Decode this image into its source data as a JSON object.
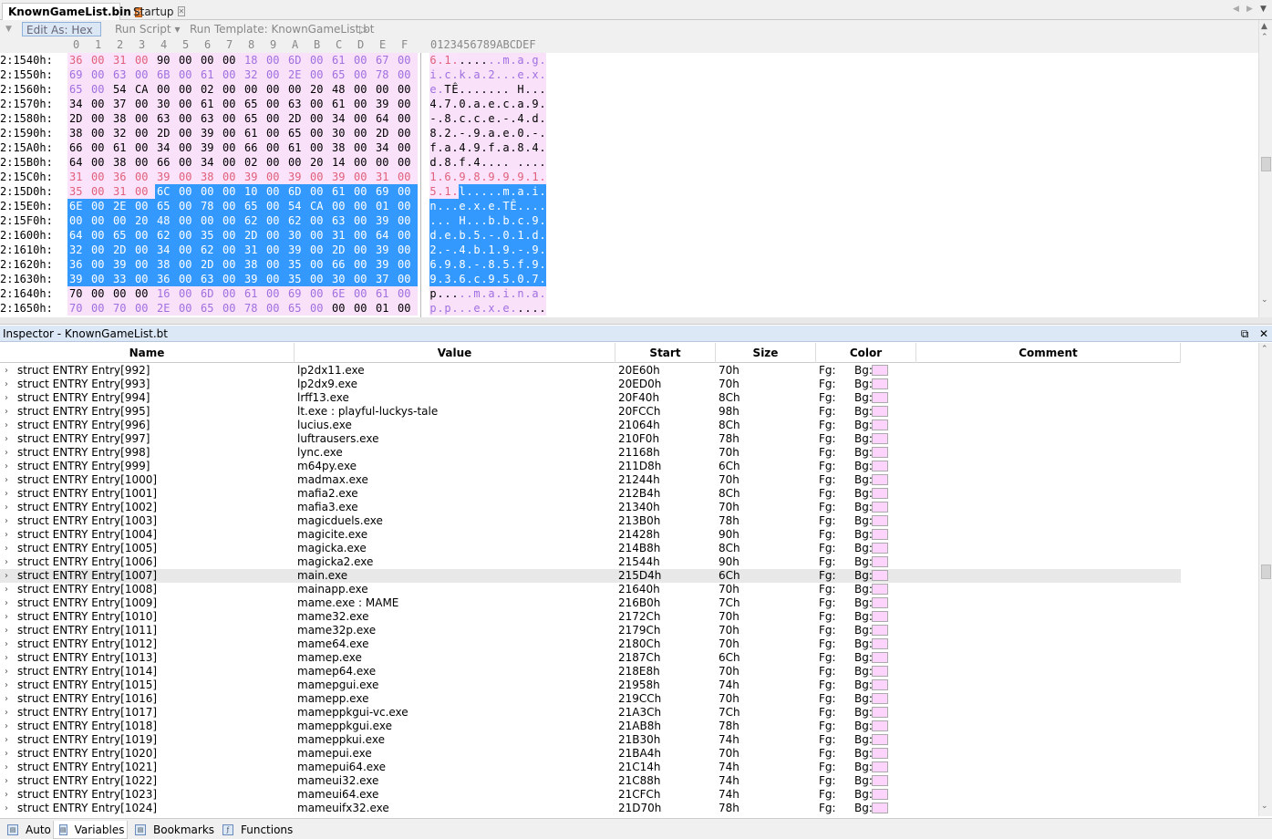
{
  "tabs": [
    {
      "label": "KnownGameList.bin",
      "active": true
    },
    {
      "label": "Startup",
      "active": false
    }
  ],
  "toolbar": {
    "edit_as": "Edit As: Hex",
    "run_script": "Run Script",
    "run_template": "Run Template: KnownGameList.bt"
  },
  "hex_columns": [
    "0",
    "1",
    "2",
    "3",
    "4",
    "5",
    "6",
    "7",
    "8",
    "9",
    "A",
    "B",
    "C",
    "D",
    "E",
    "F"
  ],
  "char_header": "0123456789ABCDEF",
  "colors": {
    "pink_bg": "#fbe3fb",
    "pink_text": "#e0607a",
    "lilac_text": "#a070e0",
    "selection": "#3399ff",
    "template_bg": "#f9e1f9"
  },
  "hex_rows": [
    {
      "addr": "2:1540h:",
      "bytes": [
        "36",
        "00",
        "31",
        "00",
        "90",
        "00",
        "00",
        "00",
        "18",
        "00",
        "6D",
        "00",
        "61",
        "00",
        "67",
        "00"
      ],
      "ascii": "6.1.......m.a.g.",
      "styles": "RRRRWWWWLLLLLLLL"
    },
    {
      "addr": "2:1550h:",
      "bytes": [
        "69",
        "00",
        "63",
        "00",
        "6B",
        "00",
        "61",
        "00",
        "32",
        "00",
        "2E",
        "00",
        "65",
        "00",
        "78",
        "00"
      ],
      "ascii": "i.c.k.a.2...e.x.",
      "styles": "LLLLLLLLLLLLLLLL"
    },
    {
      "addr": "2:1560h:",
      "bytes": [
        "65",
        "00",
        "54",
        "CA",
        "00",
        "00",
        "02",
        "00",
        "00",
        "00",
        "00",
        "20",
        "48",
        "00",
        "00",
        "00"
      ],
      "ascii": "e.TÊ....... H...",
      "styles": "LLWWWWWWWWWWWWWW"
    },
    {
      "addr": "2:1570h:",
      "bytes": [
        "34",
        "00",
        "37",
        "00",
        "30",
        "00",
        "61",
        "00",
        "65",
        "00",
        "63",
        "00",
        "61",
        "00",
        "39",
        "00"
      ],
      "ascii": "4.7.0.a.e.c.a.9.",
      "styles": "WWWWWWWWWWWWWWWW"
    },
    {
      "addr": "2:1580h:",
      "bytes": [
        "2D",
        "00",
        "38",
        "00",
        "63",
        "00",
        "63",
        "00",
        "65",
        "00",
        "2D",
        "00",
        "34",
        "00",
        "64",
        "00"
      ],
      "ascii": "-.8.c.c.e.-.4.d.",
      "styles": "WWWWWWWWWWWWWWWW"
    },
    {
      "addr": "2:1590h:",
      "bytes": [
        "38",
        "00",
        "32",
        "00",
        "2D",
        "00",
        "39",
        "00",
        "61",
        "00",
        "65",
        "00",
        "30",
        "00",
        "2D",
        "00"
      ],
      "ascii": "8.2.-.9.a.e.0.-.",
      "styles": "WWWWWWWWWWWWWWWW"
    },
    {
      "addr": "2:15A0h:",
      "bytes": [
        "66",
        "00",
        "61",
        "00",
        "34",
        "00",
        "39",
        "00",
        "66",
        "00",
        "61",
        "00",
        "38",
        "00",
        "34",
        "00"
      ],
      "ascii": "f.a.4.9.f.a.8.4.",
      "styles": "WWWWWWWWWWWWWWWW"
    },
    {
      "addr": "2:15B0h:",
      "bytes": [
        "64",
        "00",
        "38",
        "00",
        "66",
        "00",
        "34",
        "00",
        "02",
        "00",
        "00",
        "20",
        "14",
        "00",
        "00",
        "00"
      ],
      "ascii": "d.8.f.4.... ....",
      "styles": "WWWWWWWWWWWWWWWW"
    },
    {
      "addr": "2:15C0h:",
      "bytes": [
        "31",
        "00",
        "36",
        "00",
        "39",
        "00",
        "38",
        "00",
        "39",
        "00",
        "39",
        "00",
        "39",
        "00",
        "31",
        "00"
      ],
      "ascii": "1.6.9.8.9.9.9.1.",
      "styles": "RRRRRRRRRRRRRRRR"
    },
    {
      "addr": "2:15D0h:",
      "bytes": [
        "35",
        "00",
        "31",
        "00",
        "6C",
        "00",
        "00",
        "00",
        "10",
        "00",
        "6D",
        "00",
        "61",
        "00",
        "69",
        "00"
      ],
      "ascii": "5.1.l.....m.a.i.",
      "styles": "RRRRSSSSSSSSSSSS"
    },
    {
      "addr": "2:15E0h:",
      "bytes": [
        "6E",
        "00",
        "2E",
        "00",
        "65",
        "00",
        "78",
        "00",
        "65",
        "00",
        "54",
        "CA",
        "00",
        "00",
        "01",
        "00"
      ],
      "ascii": "n...e.x.e.TÊ....",
      "styles": "SSSSSSSSSSSSSSSS"
    },
    {
      "addr": "2:15F0h:",
      "bytes": [
        "00",
        "00",
        "00",
        "20",
        "48",
        "00",
        "00",
        "00",
        "62",
        "00",
        "62",
        "00",
        "63",
        "00",
        "39",
        "00"
      ],
      "ascii": "... H...b.b.c.9.",
      "styles": "SSSSSSSSSSSSSSSS"
    },
    {
      "addr": "2:1600h:",
      "bytes": [
        "64",
        "00",
        "65",
        "00",
        "62",
        "00",
        "35",
        "00",
        "2D",
        "00",
        "30",
        "00",
        "31",
        "00",
        "64",
        "00"
      ],
      "ascii": "d.e.b.5.-.0.1.d.",
      "styles": "SSSSSSSSSSSSSSSS"
    },
    {
      "addr": "2:1610h:",
      "bytes": [
        "32",
        "00",
        "2D",
        "00",
        "34",
        "00",
        "62",
        "00",
        "31",
        "00",
        "39",
        "00",
        "2D",
        "00",
        "39",
        "00"
      ],
      "ascii": "2.-.4.b.1.9.-.9.",
      "styles": "SSSSSSSSSSSSSSSS"
    },
    {
      "addr": "2:1620h:",
      "bytes": [
        "36",
        "00",
        "39",
        "00",
        "38",
        "00",
        "2D",
        "00",
        "38",
        "00",
        "35",
        "00",
        "66",
        "00",
        "39",
        "00"
      ],
      "ascii": "6.9.8.-.8.5.f.9.",
      "styles": "SSSSSSSSSSSSSSSS"
    },
    {
      "addr": "2:1630h:",
      "bytes": [
        "39",
        "00",
        "33",
        "00",
        "36",
        "00",
        "63",
        "00",
        "39",
        "00",
        "35",
        "00",
        "30",
        "00",
        "37",
        "00"
      ],
      "ascii": "9.3.6.c.9.5.0.7.",
      "styles": "SSSSSSSSSSSSSSSS"
    },
    {
      "addr": "2:1640h:",
      "bytes": [
        "70",
        "00",
        "00",
        "00",
        "16",
        "00",
        "6D",
        "00",
        "61",
        "00",
        "69",
        "00",
        "6E",
        "00",
        "61",
        "00"
      ],
      "ascii": "p.....m.a.i.n.a.",
      "styles": "WWWWLLLLLLLLLLLL"
    },
    {
      "addr": "2:1650h:",
      "bytes": [
        "70",
        "00",
        "70",
        "00",
        "2E",
        "00",
        "65",
        "00",
        "78",
        "00",
        "65",
        "00",
        "00",
        "00",
        "01",
        "00"
      ],
      "ascii": "p.p...e.x.e.....",
      "styles": "LLLLLLLLLLLLWWWW"
    }
  ],
  "inspector": {
    "title": "Inspector - KnownGameList.bt",
    "columns": [
      "Name",
      "Value",
      "Start",
      "Size",
      "Color",
      "Comment"
    ],
    "rows": [
      [
        "struct ENTRY Entry[992]",
        "lp2dx11.exe",
        "20E60h",
        "70h"
      ],
      [
        "struct ENTRY Entry[993]",
        "lp2dx9.exe",
        "20ED0h",
        "70h"
      ],
      [
        "struct ENTRY Entry[994]",
        "lrff13.exe",
        "20F40h",
        "8Ch"
      ],
      [
        "struct ENTRY Entry[995]",
        "lt.exe : playful-luckys-tale",
        "20FCCh",
        "98h"
      ],
      [
        "struct ENTRY Entry[996]",
        "lucius.exe",
        "21064h",
        "8Ch"
      ],
      [
        "struct ENTRY Entry[997]",
        "luftrausers.exe",
        "210F0h",
        "78h"
      ],
      [
        "struct ENTRY Entry[998]",
        "lync.exe",
        "21168h",
        "70h"
      ],
      [
        "struct ENTRY Entry[999]",
        "m64py.exe",
        "211D8h",
        "6Ch"
      ],
      [
        "struct ENTRY Entry[1000]",
        "madmax.exe",
        "21244h",
        "70h"
      ],
      [
        "struct ENTRY Entry[1001]",
        "mafia2.exe",
        "212B4h",
        "8Ch"
      ],
      [
        "struct ENTRY Entry[1002]",
        "mafia3.exe",
        "21340h",
        "70h"
      ],
      [
        "struct ENTRY Entry[1003]",
        "magicduels.exe",
        "213B0h",
        "78h"
      ],
      [
        "struct ENTRY Entry[1004]",
        "magicite.exe",
        "21428h",
        "90h"
      ],
      [
        "struct ENTRY Entry[1005]",
        "magicka.exe",
        "214B8h",
        "8Ch"
      ],
      [
        "struct ENTRY Entry[1006]",
        "magicka2.exe",
        "21544h",
        "90h"
      ],
      [
        "struct ENTRY Entry[1007]",
        "main.exe",
        "215D4h",
        "6Ch"
      ],
      [
        "struct ENTRY Entry[1008]",
        "mainapp.exe",
        "21640h",
        "70h"
      ],
      [
        "struct ENTRY Entry[1009]",
        "mame.exe : MAME",
        "216B0h",
        "7Ch"
      ],
      [
        "struct ENTRY Entry[1010]",
        "mame32.exe",
        "2172Ch",
        "70h"
      ],
      [
        "struct ENTRY Entry[1011]",
        "mame32p.exe",
        "2179Ch",
        "70h"
      ],
      [
        "struct ENTRY Entry[1012]",
        "mame64.exe",
        "2180Ch",
        "70h"
      ],
      [
        "struct ENTRY Entry[1013]",
        "mamep.exe",
        "2187Ch",
        "6Ch"
      ],
      [
        "struct ENTRY Entry[1014]",
        "mamep64.exe",
        "218E8h",
        "70h"
      ],
      [
        "struct ENTRY Entry[1015]",
        "mamepgui.exe",
        "21958h",
        "74h"
      ],
      [
        "struct ENTRY Entry[1016]",
        "mamepp.exe",
        "219CCh",
        "70h"
      ],
      [
        "struct ENTRY Entry[1017]",
        "mameppkgui-vc.exe",
        "21A3Ch",
        "7Ch"
      ],
      [
        "struct ENTRY Entry[1018]",
        "mameppkgui.exe",
        "21AB8h",
        "78h"
      ],
      [
        "struct ENTRY Entry[1019]",
        "mameppkui.exe",
        "21B30h",
        "74h"
      ],
      [
        "struct ENTRY Entry[1020]",
        "mamepui.exe",
        "21BA4h",
        "70h"
      ],
      [
        "struct ENTRY Entry[1021]",
        "mamepui64.exe",
        "21C14h",
        "74h"
      ],
      [
        "struct ENTRY Entry[1022]",
        "mameui32.exe",
        "21C88h",
        "74h"
      ],
      [
        "struct ENTRY Entry[1023]",
        "mameui64.exe",
        "21CFCh",
        "74h"
      ],
      [
        "struct ENTRY Entry[1024]",
        "mameuifx32.exe",
        "21D70h",
        "78h"
      ]
    ],
    "fg_label": "Fg:",
    "bg_label": "Bg:",
    "selected_row": 15
  },
  "bottom_tabs": [
    {
      "label": "Auto",
      "icon": "auto-icon"
    },
    {
      "label": "Variables",
      "icon": "variables-icon",
      "active": true
    },
    {
      "label": "Bookmarks",
      "icon": "bookmarks-icon"
    },
    {
      "label": "Functions",
      "icon": "functions-icon"
    }
  ]
}
